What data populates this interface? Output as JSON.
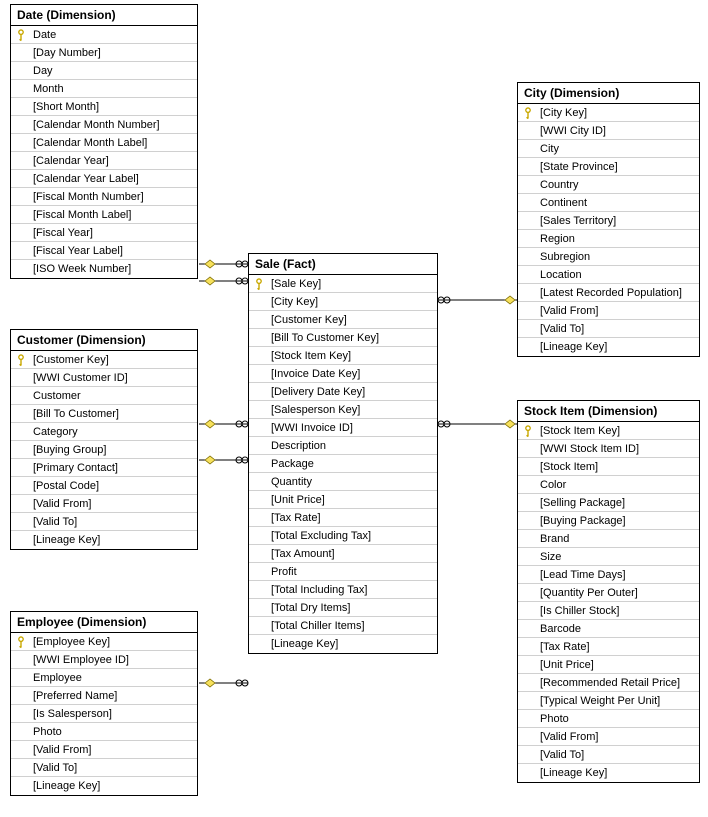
{
  "entities": {
    "date": {
      "title": "Date (Dimension)",
      "columns": [
        {
          "pk": true,
          "label": "Date"
        },
        {
          "pk": false,
          "label": "[Day Number]"
        },
        {
          "pk": false,
          "label": "Day"
        },
        {
          "pk": false,
          "label": "Month"
        },
        {
          "pk": false,
          "label": "[Short Month]"
        },
        {
          "pk": false,
          "label": "[Calendar Month Number]"
        },
        {
          "pk": false,
          "label": "[Calendar Month Label]"
        },
        {
          "pk": false,
          "label": "[Calendar Year]"
        },
        {
          "pk": false,
          "label": "[Calendar Year Label]"
        },
        {
          "pk": false,
          "label": "[Fiscal Month Number]"
        },
        {
          "pk": false,
          "label": "[Fiscal Month Label]"
        },
        {
          "pk": false,
          "label": "[Fiscal Year]"
        },
        {
          "pk": false,
          "label": "[Fiscal Year Label]"
        },
        {
          "pk": false,
          "label": "[ISO Week Number]"
        }
      ]
    },
    "customer": {
      "title": "Customer (Dimension)",
      "columns": [
        {
          "pk": true,
          "label": "[Customer Key]"
        },
        {
          "pk": false,
          "label": "[WWI Customer ID]"
        },
        {
          "pk": false,
          "label": "Customer"
        },
        {
          "pk": false,
          "label": "[Bill To Customer]"
        },
        {
          "pk": false,
          "label": "Category"
        },
        {
          "pk": false,
          "label": "[Buying Group]"
        },
        {
          "pk": false,
          "label": "[Primary Contact]"
        },
        {
          "pk": false,
          "label": "[Postal Code]"
        },
        {
          "pk": false,
          "label": "[Valid From]"
        },
        {
          "pk": false,
          "label": "[Valid To]"
        },
        {
          "pk": false,
          "label": "[Lineage Key]"
        }
      ]
    },
    "employee": {
      "title": "Employee (Dimension)",
      "columns": [
        {
          "pk": true,
          "label": "[Employee Key]"
        },
        {
          "pk": false,
          "label": "[WWI Employee ID]"
        },
        {
          "pk": false,
          "label": "Employee"
        },
        {
          "pk": false,
          "label": "[Preferred Name]"
        },
        {
          "pk": false,
          "label": "[Is Salesperson]"
        },
        {
          "pk": false,
          "label": "Photo"
        },
        {
          "pk": false,
          "label": "[Valid From]"
        },
        {
          "pk": false,
          "label": "[Valid To]"
        },
        {
          "pk": false,
          "label": "[Lineage Key]"
        }
      ]
    },
    "sale": {
      "title": "Sale (Fact)",
      "columns": [
        {
          "pk": true,
          "label": "[Sale Key]"
        },
        {
          "pk": false,
          "label": "[City Key]"
        },
        {
          "pk": false,
          "label": "[Customer Key]"
        },
        {
          "pk": false,
          "label": "[Bill To Customer Key]"
        },
        {
          "pk": false,
          "label": "[Stock Item Key]"
        },
        {
          "pk": false,
          "label": "[Invoice Date Key]"
        },
        {
          "pk": false,
          "label": "[Delivery Date Key]"
        },
        {
          "pk": false,
          "label": "[Salesperson Key]"
        },
        {
          "pk": false,
          "label": "[WWI Invoice ID]"
        },
        {
          "pk": false,
          "label": "Description"
        },
        {
          "pk": false,
          "label": "Package"
        },
        {
          "pk": false,
          "label": "Quantity"
        },
        {
          "pk": false,
          "label": "[Unit Price]"
        },
        {
          "pk": false,
          "label": "[Tax Rate]"
        },
        {
          "pk": false,
          "label": "[Total Excluding Tax]"
        },
        {
          "pk": false,
          "label": "[Tax Amount]"
        },
        {
          "pk": false,
          "label": "Profit"
        },
        {
          "pk": false,
          "label": "[Total Including Tax]"
        },
        {
          "pk": false,
          "label": "[Total Dry Items]"
        },
        {
          "pk": false,
          "label": "[Total Chiller Items]"
        },
        {
          "pk": false,
          "label": "[Lineage Key]"
        }
      ]
    },
    "city": {
      "title": "City (Dimension)",
      "columns": [
        {
          "pk": true,
          "label": "[City Key]"
        },
        {
          "pk": false,
          "label": "[WWI City ID]"
        },
        {
          "pk": false,
          "label": "City"
        },
        {
          "pk": false,
          "label": "[State Province]"
        },
        {
          "pk": false,
          "label": "Country"
        },
        {
          "pk": false,
          "label": "Continent"
        },
        {
          "pk": false,
          "label": "[Sales Territory]"
        },
        {
          "pk": false,
          "label": "Region"
        },
        {
          "pk": false,
          "label": "Subregion"
        },
        {
          "pk": false,
          "label": "Location"
        },
        {
          "pk": false,
          "label": "[Latest Recorded Population]"
        },
        {
          "pk": false,
          "label": "[Valid From]"
        },
        {
          "pk": false,
          "label": "[Valid To]"
        },
        {
          "pk": false,
          "label": "[Lineage Key]"
        }
      ]
    },
    "stockitem": {
      "title": "Stock Item (Dimension)",
      "columns": [
        {
          "pk": true,
          "label": "[Stock Item Key]"
        },
        {
          "pk": false,
          "label": "[WWI Stock Item ID]"
        },
        {
          "pk": false,
          "label": "[Stock Item]"
        },
        {
          "pk": false,
          "label": "Color"
        },
        {
          "pk": false,
          "label": "[Selling Package]"
        },
        {
          "pk": false,
          "label": "[Buying Package]"
        },
        {
          "pk": false,
          "label": "Brand"
        },
        {
          "pk": false,
          "label": "Size"
        },
        {
          "pk": false,
          "label": "[Lead Time Days]"
        },
        {
          "pk": false,
          "label": "[Quantity Per Outer]"
        },
        {
          "pk": false,
          "label": "[Is Chiller Stock]"
        },
        {
          "pk": false,
          "label": "Barcode"
        },
        {
          "pk": false,
          "label": "[Tax Rate]"
        },
        {
          "pk": false,
          "label": "[Unit Price]"
        },
        {
          "pk": false,
          "label": "[Recommended Retail Price]"
        },
        {
          "pk": false,
          "label": "[Typical Weight Per Unit]"
        },
        {
          "pk": false,
          "label": "Photo"
        },
        {
          "pk": false,
          "label": "[Valid From]"
        },
        {
          "pk": false,
          "label": "[Valid To]"
        },
        {
          "pk": false,
          "label": "[Lineage Key]"
        }
      ]
    }
  },
  "relationships": [
    {
      "from": "sale",
      "to": "date",
      "desc": "Sale.[Invoice Date Key] → Date.Date"
    },
    {
      "from": "sale",
      "to": "date",
      "desc": "Sale.[Delivery Date Key] → Date.Date"
    },
    {
      "from": "sale",
      "to": "customer",
      "desc": "Sale.[Customer Key] → Customer.[Customer Key]"
    },
    {
      "from": "sale",
      "to": "customer",
      "desc": "Sale.[Bill To Customer Key] → Customer.[Customer Key]"
    },
    {
      "from": "sale",
      "to": "employee",
      "desc": "Sale.[Salesperson Key] → Employee.[Employee Key]"
    },
    {
      "from": "sale",
      "to": "city",
      "desc": "Sale.[City Key] → City.[City Key]"
    },
    {
      "from": "sale",
      "to": "stockitem",
      "desc": "Sale.[Stock Item Key] → Stock Item.[Stock Item Key]"
    }
  ]
}
